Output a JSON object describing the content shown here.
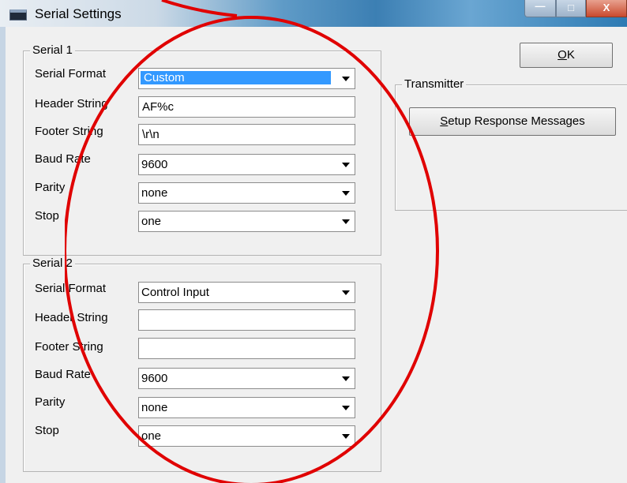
{
  "window": {
    "title": "Serial Settings",
    "close_glyph": "X"
  },
  "buttons": {
    "ok_prefix": "O",
    "ok_rest": "K",
    "setup_prefix": "S",
    "setup_rest": "etup Response Messages"
  },
  "transmitter": {
    "legend": "Transmitter"
  },
  "serial1": {
    "legend": "Serial 1",
    "labels": {
      "format": "Serial Format",
      "header": "Header String",
      "footer": "Footer String",
      "baud": "Baud Rate",
      "parity": "Parity",
      "stop": "Stop"
    },
    "values": {
      "format": "Custom",
      "header": "AF%c",
      "footer": "\\r\\n",
      "baud": "9600",
      "parity": "none",
      "stop": "one"
    }
  },
  "serial2": {
    "legend": "Serial 2",
    "labels": {
      "format": "Serial Format",
      "header": "Header String",
      "footer": "Footer String",
      "baud": "Baud Rate",
      "parity": "Parity",
      "stop": "Stop"
    },
    "values": {
      "format": "Control Input",
      "header": "",
      "footer": "",
      "baud": "9600",
      "parity": "none",
      "stop": "one"
    }
  },
  "colors": {
    "annotation": "#e00000",
    "selection": "#3399ff"
  }
}
